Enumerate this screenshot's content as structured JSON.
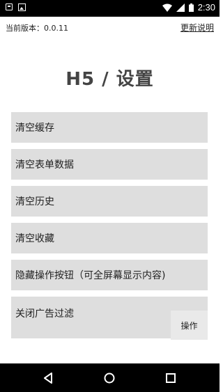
{
  "status_bar": {
    "time": "2:30",
    "icons": [
      "notification-icon",
      "image-icon",
      "wifi-icon",
      "signal-icon",
      "battery-icon"
    ]
  },
  "header": {
    "version_label": "当前版本：0.0.11",
    "changelog_link": "更新说明"
  },
  "title": "H5 / 设置",
  "menu": {
    "items": [
      {
        "label": "清空缓存"
      },
      {
        "label": "清空表单数据"
      },
      {
        "label": "清空历史"
      },
      {
        "label": "清空收藏"
      },
      {
        "label": "隐藏操作按钮（可全屏幕显示内容)"
      },
      {
        "label": "关闭广告过滤"
      }
    ],
    "action_label": "操作"
  },
  "nav_bar": {
    "icons": [
      "back-icon",
      "home-icon",
      "recents-icon"
    ]
  }
}
